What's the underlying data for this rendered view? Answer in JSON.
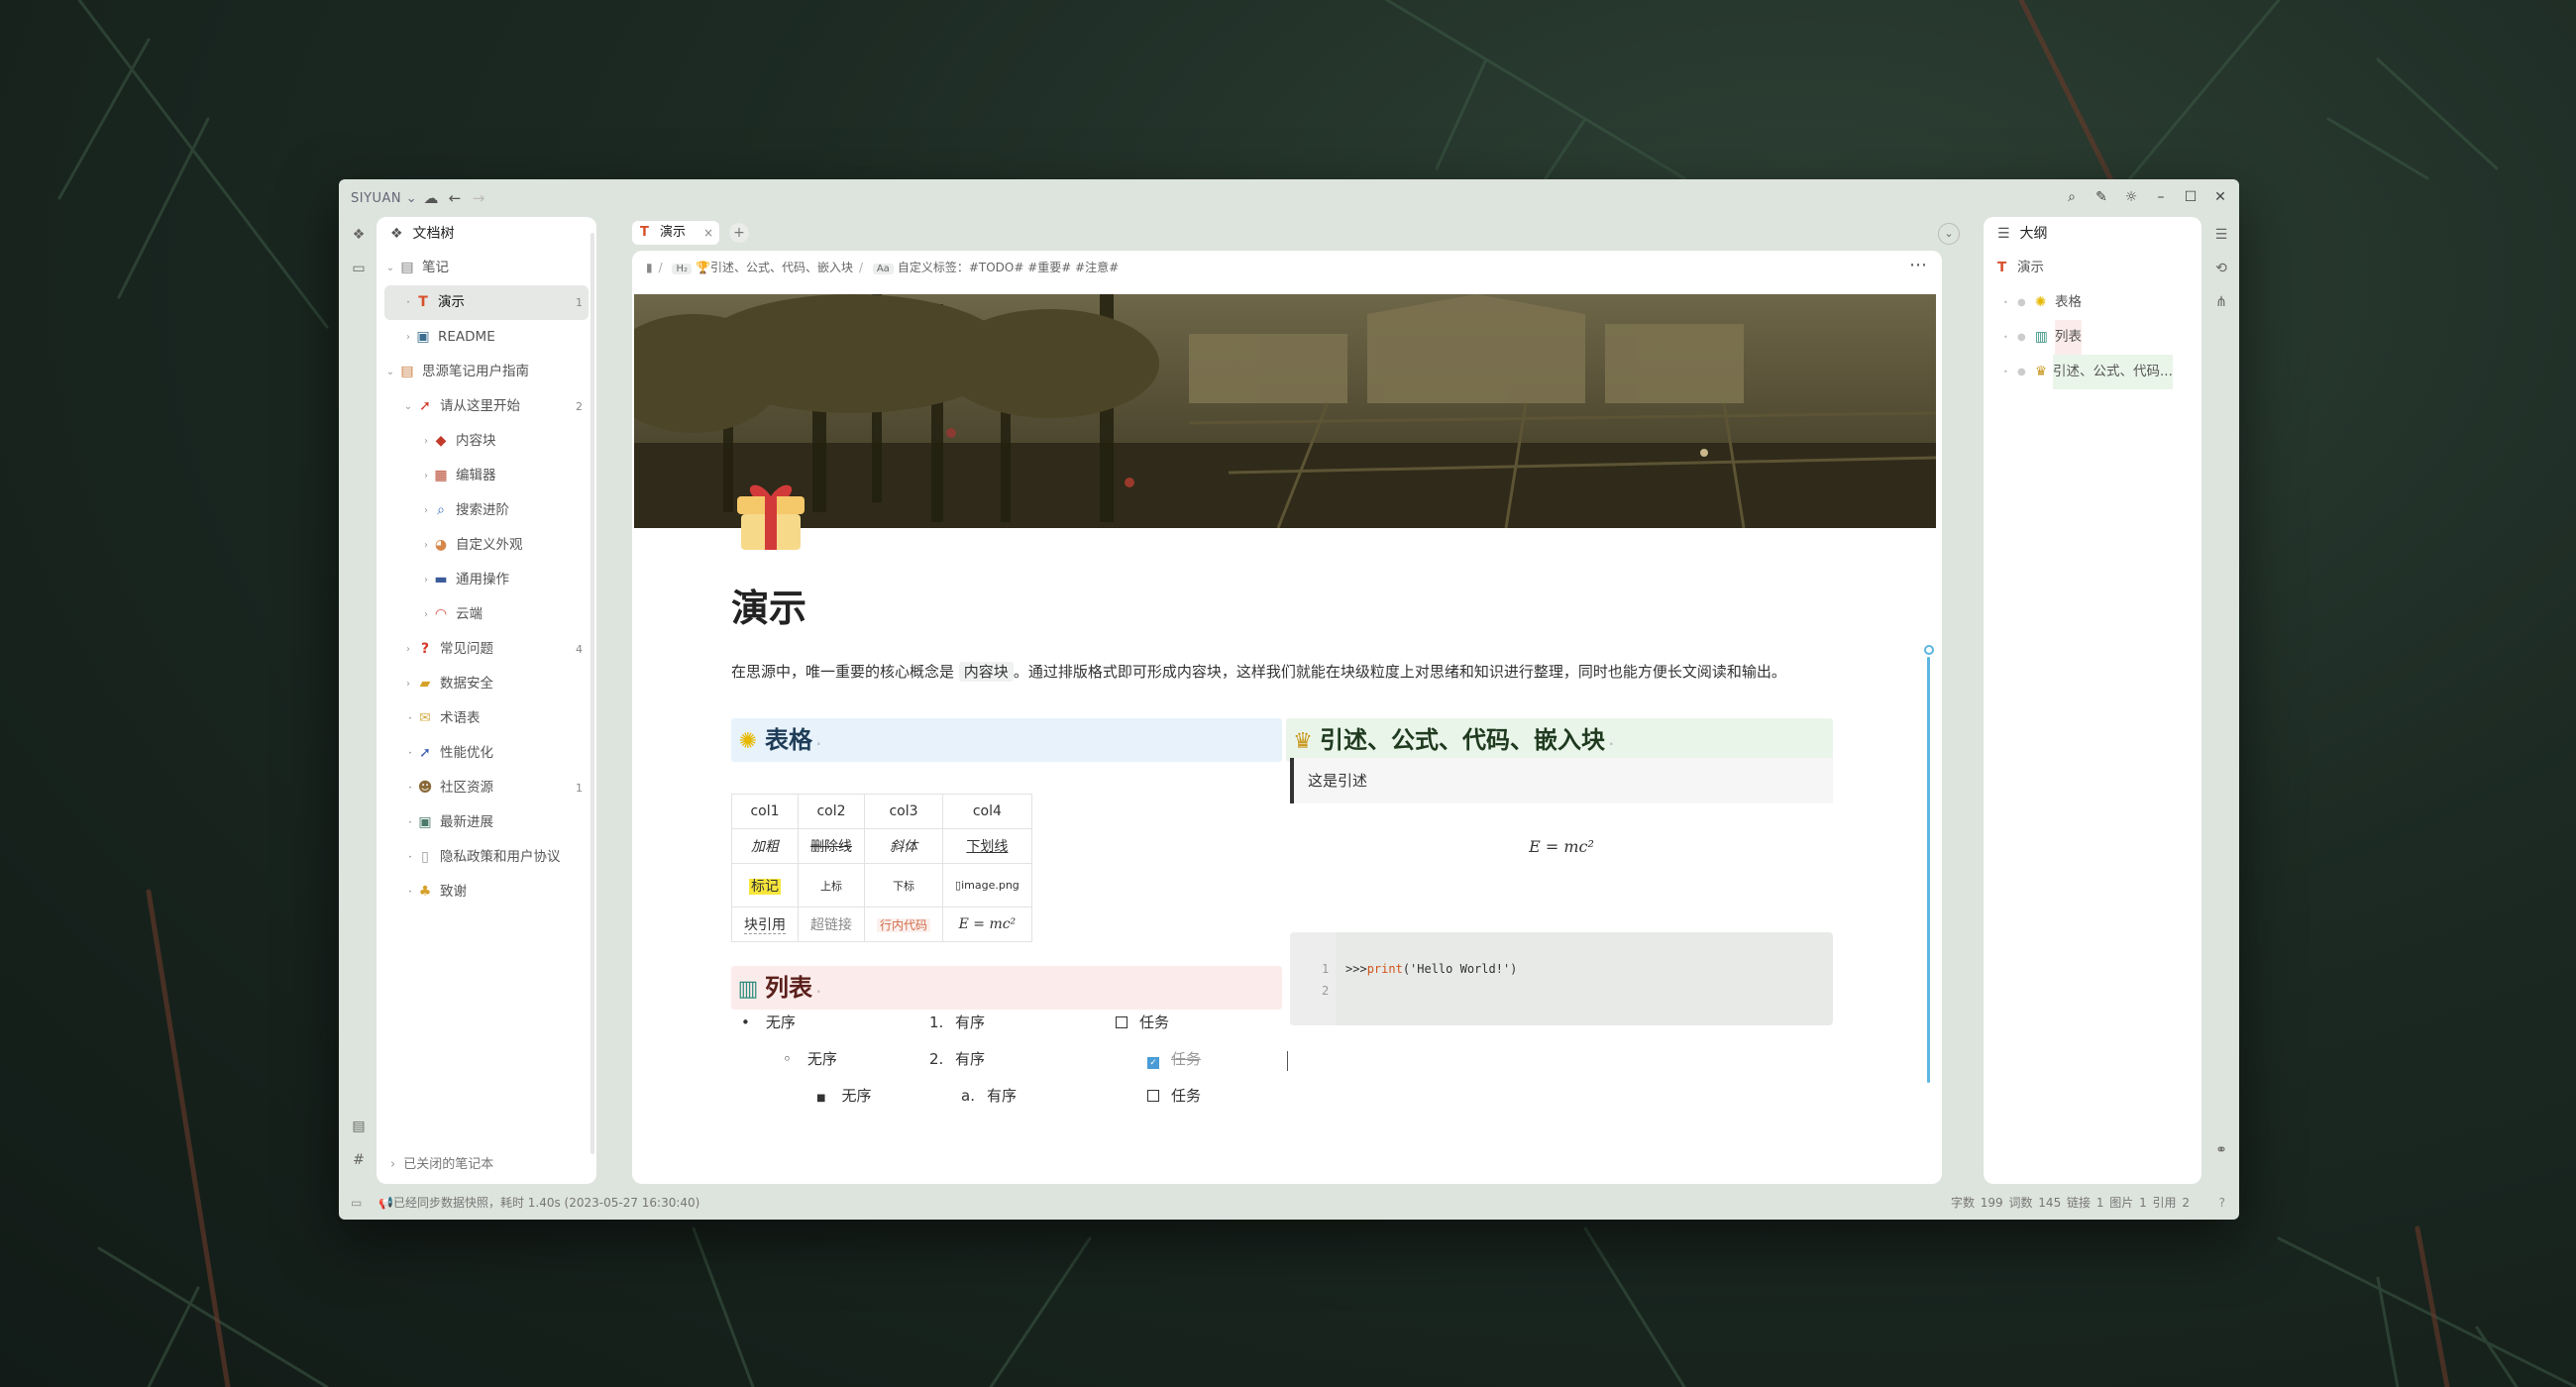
{
  "app": {
    "brand": "SIYUAN ⌄"
  },
  "tree": {
    "title": "文档树",
    "rows": [
      {
        "label": "笔记",
        "icon": "notebook-icon"
      },
      {
        "label": "演示",
        "count": "1",
        "icon": "t-icon"
      },
      {
        "label": "README",
        "icon": "image-icon"
      },
      {
        "label": "思源笔记用户指南",
        "icon": "book-icon"
      },
      {
        "label": "请从这里开始",
        "count": "2",
        "icon": "rocket-icon"
      },
      {
        "label": "内容块",
        "icon": "dice-icon"
      },
      {
        "label": "编辑器",
        "icon": "palette-icon"
      },
      {
        "label": "搜索进阶",
        "icon": "magnifier-icon"
      },
      {
        "label": "自定义外观",
        "icon": "art-icon"
      },
      {
        "label": "通用操作",
        "icon": "car-icon"
      },
      {
        "label": "云端",
        "icon": "rainbow-icon"
      },
      {
        "label": "常见问题",
        "count": "4",
        "icon": "question-icon"
      },
      {
        "label": "数据安全",
        "icon": "truck-icon"
      },
      {
        "label": "术语表",
        "icon": "envelope-icon"
      },
      {
        "label": "性能优化",
        "icon": "rocket-2-icon"
      },
      {
        "label": "社区资源",
        "count": "1",
        "icon": "people-icon"
      },
      {
        "label": "最新进展",
        "icon": "picture-icon"
      },
      {
        "label": "隐私政策和用户协议",
        "icon": "doc-icon"
      },
      {
        "label": "致谢",
        "icon": "people-hands-icon"
      }
    ],
    "closed_label": "已关闭的笔记本"
  },
  "tab": {
    "label": "演示",
    "close": "×",
    "add": "+"
  },
  "breadcrumb": {
    "h_badge": "H₂",
    "item1": "🏆引述、公式、代码、嵌入块",
    "aa_badge": "Aa",
    "item2": "自定义标签：#TODO# #重要# #注意#"
  },
  "editor": {
    "title": "演示",
    "intro_before": "在思源中，唯一重要的核心概念是",
    "intro_chip": "内容块",
    "intro_after": "。通过排版格式即可形成内容块，这样我们就能在块级粒度上对思绪和知识进行整理，同时也能方便长文阅读和输出。",
    "table_heading": "表格",
    "table": {
      "header": [
        "col1",
        "col2",
        "col3",
        "col4"
      ],
      "row1": [
        "加粗",
        "删除线",
        "斜体",
        "下划线"
      ],
      "row2": [
        "标记",
        "上标",
        "下标",
        "image.png"
      ],
      "row3": [
        "块引用",
        "超链接",
        "行内代码",
        "E = mc²"
      ]
    },
    "list_heading": "列表",
    "lists": {
      "unordered": [
        "无序",
        "无序",
        "无序"
      ],
      "ordered": [
        "有序",
        "有序",
        "有序"
      ],
      "ordered_markers": [
        "1.",
        "2.",
        "a."
      ],
      "tasks": [
        "任务",
        "任务",
        "任务"
      ]
    },
    "quote_heading": "引述、公式、代码、嵌入块",
    "quote_text": "这是引述",
    "math": "E = mc²",
    "code": {
      "ln1": "1",
      "ln2": "2",
      "prompt": ">>>",
      "fn": "print",
      "rest": "('Hello World!')"
    }
  },
  "outline": {
    "title": "大纲",
    "root": "演示",
    "items": [
      "表格",
      "列表",
      "引述、公式、代码..."
    ]
  },
  "status": {
    "left": "📢已经同步数据快照，耗时 1.40s (2023-05-27 16:30:40)",
    "right": "字数 199  词数 145  链接 1  图片 1  引用 2"
  },
  "colors": {
    "accent": "#5db6e0",
    "heading_table_bg": "#e7f2fb",
    "heading_list_bg": "#fbeceb",
    "heading_quote_bg": "#eaf5ea"
  }
}
